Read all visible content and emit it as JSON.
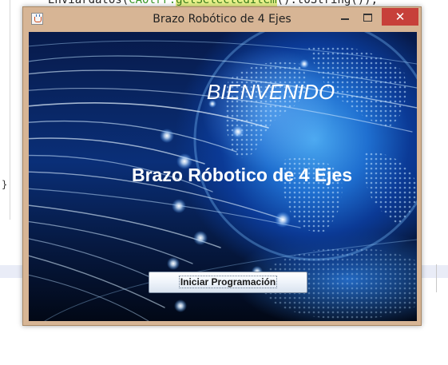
{
  "background_editor": {
    "code_line_parts": [
      "Enviardatos(",
      "CAOtrr.",
      "getSelectedItem",
      "().toString());"
    ],
    "closing_brace": "}"
  },
  "window": {
    "title": "Brazo Robótico de 4 Ejes",
    "minimize_symbol": "",
    "maximize_symbol": "",
    "close_symbol": "✕",
    "icon": "java-cup-icon"
  },
  "content": {
    "welcome_text": "BIENVENIDO",
    "heading": "Brazo Róbotico de 4 Ejes",
    "start_button_label": "Iniciar Programación",
    "background_image": "globe-fiber-optics-illustration"
  },
  "colors": {
    "window_frame": "#d7b595",
    "close_button": "#c7403a",
    "text_on_image": "#ffffff"
  }
}
